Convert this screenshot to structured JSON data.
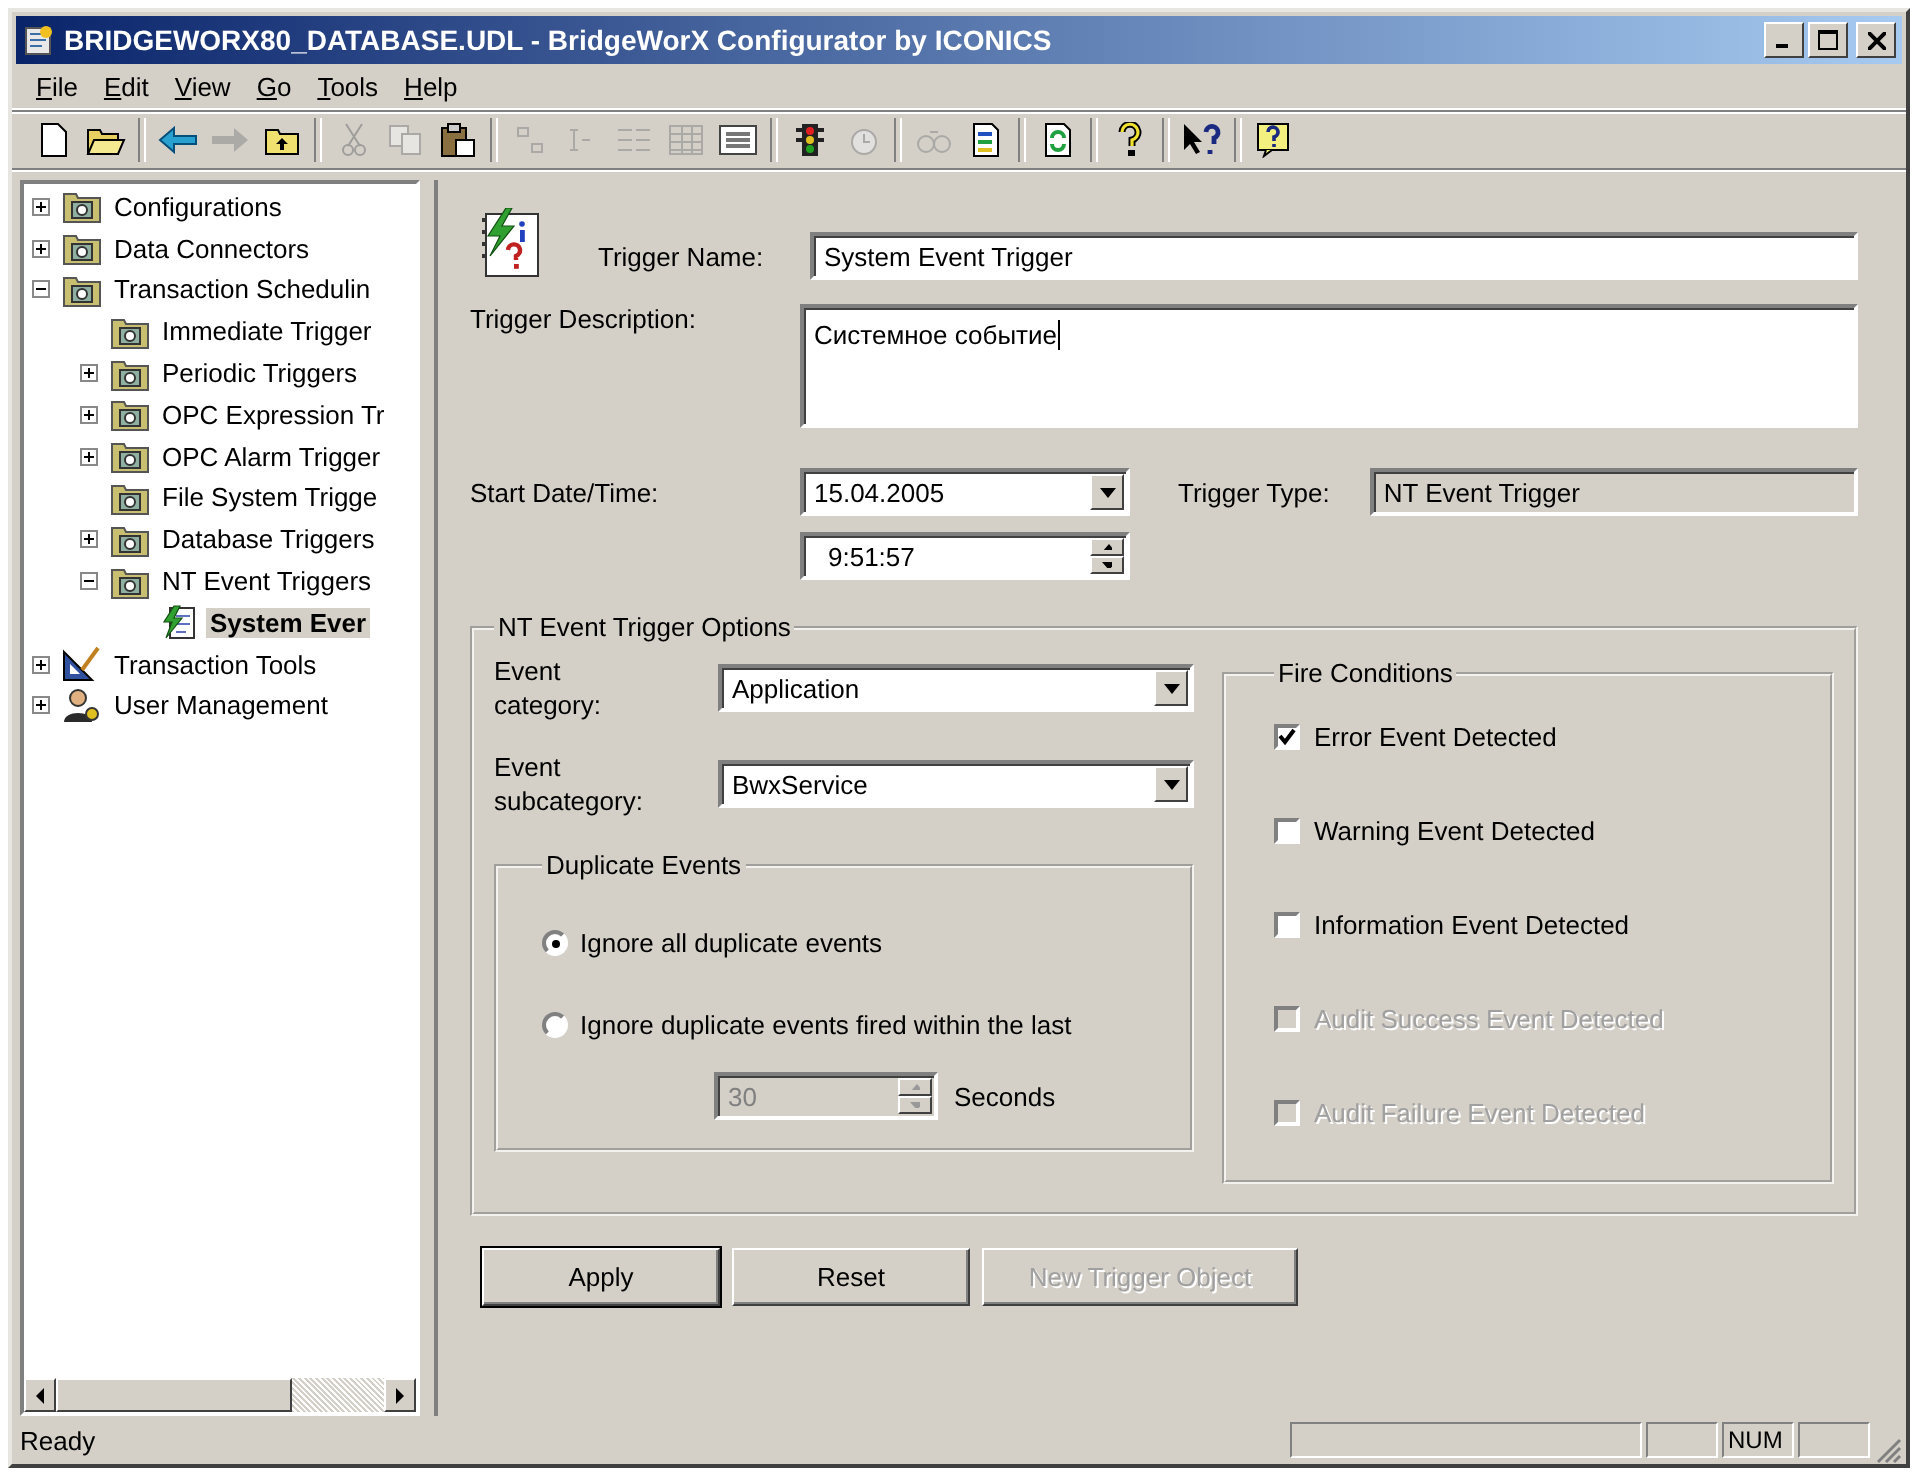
{
  "window": {
    "title": "BRIDGEWORX80_DATABASE.UDL - BridgeWorX Configurator by ICONICS"
  },
  "menu": [
    "File",
    "Edit",
    "View",
    "Go",
    "Tools",
    "Help"
  ],
  "toolbar": [
    {
      "kind": "new",
      "disabled": false
    },
    {
      "kind": "open",
      "disabled": false
    },
    {
      "kind": "separator"
    },
    {
      "kind": "back",
      "disabled": false
    },
    {
      "kind": "forward",
      "disabled": true
    },
    {
      "kind": "up",
      "disabled": false
    },
    {
      "kind": "separator"
    },
    {
      "kind": "cut",
      "disabled": true
    },
    {
      "kind": "copy",
      "disabled": true
    },
    {
      "kind": "paste",
      "disabled": false
    },
    {
      "kind": "separator"
    },
    {
      "kind": "large-icons",
      "disabled": true
    },
    {
      "kind": "small-icons",
      "disabled": true
    },
    {
      "kind": "list",
      "disabled": true
    },
    {
      "kind": "details",
      "disabled": true
    },
    {
      "kind": "properties",
      "disabled": false
    },
    {
      "kind": "separator"
    },
    {
      "kind": "traffic-light",
      "disabled": false
    },
    {
      "kind": "history",
      "disabled": true
    },
    {
      "kind": "separator"
    },
    {
      "kind": "find",
      "disabled": true
    },
    {
      "kind": "report",
      "disabled": false
    },
    {
      "kind": "separator"
    },
    {
      "kind": "refresh",
      "disabled": false
    },
    {
      "kind": "separator"
    },
    {
      "kind": "help",
      "disabled": false
    },
    {
      "kind": "separator"
    },
    {
      "kind": "context-help",
      "disabled": false
    },
    {
      "kind": "separator"
    },
    {
      "kind": "about",
      "disabled": false
    }
  ],
  "tree": [
    {
      "label": "Configurations",
      "kind": "folder",
      "expanded": false,
      "selected": false
    },
    {
      "label": "Data Connectors",
      "kind": "folder",
      "expanded": false,
      "selected": false
    },
    {
      "label": "Transaction Schedulin",
      "kind": "folder",
      "expanded": true,
      "selected": false,
      "children": [
        {
          "label": "Immediate Trigger",
          "kind": "folder",
          "selected": false
        },
        {
          "label": "Periodic Triggers",
          "kind": "folder",
          "expanded": false,
          "selected": false
        },
        {
          "label": "OPC Expression Tr",
          "kind": "folder",
          "expanded": false,
          "selected": false
        },
        {
          "label": "OPC Alarm Trigger",
          "kind": "folder",
          "expanded": false,
          "selected": false
        },
        {
          "label": "File System Trigge",
          "kind": "folder",
          "selected": false
        },
        {
          "label": "Database Triggers",
          "kind": "folder",
          "expanded": false,
          "selected": false
        },
        {
          "label": "NT Event Triggers",
          "kind": "folder",
          "expanded": true,
          "selected": false,
          "children": [
            {
              "label": "System Ever",
              "kind": "item",
              "selected": true
            }
          ]
        }
      ]
    },
    {
      "label": "Transaction Tools",
      "kind": "tools",
      "expanded": false,
      "selected": false
    },
    {
      "label": "User Management",
      "kind": "users",
      "expanded": false,
      "selected": false
    }
  ],
  "form": {
    "trigger_name": {
      "label": "Trigger Name:",
      "value": "System Event Trigger"
    },
    "trigger_description": {
      "label": "Trigger Description:",
      "value": "Системное событие"
    },
    "start": {
      "label": "Start Date/Time:",
      "date": "15.04.2005",
      "time": "9:51:57"
    },
    "trigger_type": {
      "label": "Trigger Type:",
      "value": "NT Event Trigger"
    },
    "options": {
      "title": "NT Event Trigger Options",
      "event_category": {
        "label": "Event category:",
        "value": "Application"
      },
      "event_subcategory": {
        "label": "Event subcategory:",
        "value": "BwxService"
      },
      "duplicate_events": {
        "title": "Duplicate Events",
        "options": [
          {
            "label": "Ignore all duplicate events",
            "selected": true
          },
          {
            "label": "Ignore duplicate events fired within the last",
            "selected": false
          }
        ],
        "interval": {
          "value": "30",
          "unit": "Seconds",
          "disabled": true
        }
      },
      "fire_conditions": {
        "title": "Fire Conditions",
        "items": [
          {
            "label": "Error Event Detected",
            "checked": true,
            "disabled": false
          },
          {
            "label": "Warning Event Detected",
            "checked": false,
            "disabled": false
          },
          {
            "label": "Information Event Detected",
            "checked": false,
            "disabled": false
          },
          {
            "label": "Audit Success Event Detected",
            "checked": false,
            "disabled": true
          },
          {
            "label": "Audit Failure Event Detected",
            "checked": false,
            "disabled": true
          }
        ]
      }
    },
    "buttons": [
      {
        "label": "Apply",
        "default": true,
        "disabled": false
      },
      {
        "label": "Reset",
        "default": false,
        "disabled": false
      },
      {
        "label": "New Trigger Object",
        "default": false,
        "disabled": true
      }
    ]
  },
  "status_bar": {
    "text": "Ready",
    "indicators": [
      "NUM"
    ]
  }
}
